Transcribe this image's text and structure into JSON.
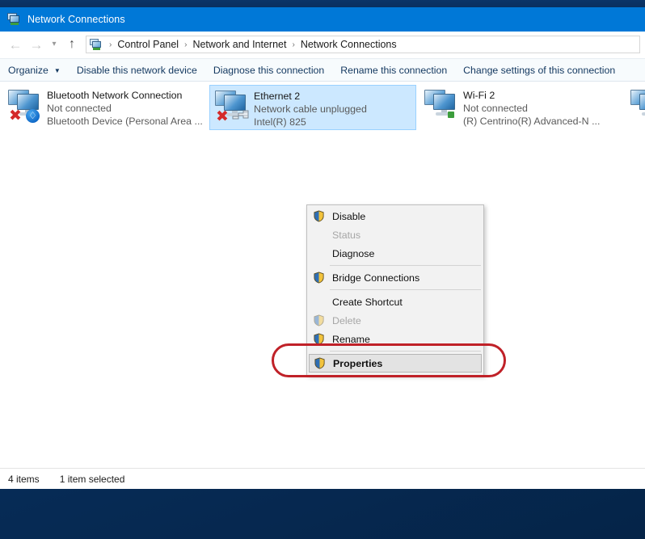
{
  "window": {
    "title": "Network Connections",
    "title_icon": "network-connections-icon"
  },
  "navigation": {
    "back_icon": "back-arrow-icon",
    "forward_icon": "forward-arrow-icon",
    "history_icon": "chevron-down-icon",
    "up_icon": "up-arrow-icon",
    "address_icon": "network-connections-icon",
    "breadcrumbs": [
      {
        "label": "Control Panel"
      },
      {
        "label": "Network and Internet"
      },
      {
        "label": "Network Connections"
      }
    ],
    "separator": "›"
  },
  "command_bar": {
    "items": [
      {
        "label": "Organize",
        "has_caret": true
      },
      {
        "label": "Disable this network device",
        "has_caret": false
      },
      {
        "label": "Diagnose this connection",
        "has_caret": false
      },
      {
        "label": "Rename this connection",
        "has_caret": false
      },
      {
        "label": "Change settings of this connection",
        "has_caret": false
      }
    ],
    "caret": "▼"
  },
  "connections": [
    {
      "name": "Bluetooth Network Connection",
      "status": "Not connected",
      "device": "Bluetooth Device (Personal Area ...",
      "icon": "network-adapter-icon",
      "badge": "bluetooth-badge-icon",
      "badge_glyph": "ᛦ",
      "disconnected": true,
      "selected": false
    },
    {
      "name": "Ethernet 2",
      "status": "Network cable unplugged",
      "device": "Intel(R) 825",
      "icon": "network-adapter-icon",
      "badge": "unplugged-cable-badge-icon",
      "disconnected": true,
      "selected": true
    },
    {
      "name": "Wi-Fi 2",
      "status": "Not connected",
      "device": "(R) Centrino(R) Advanced-N ...",
      "icon": "network-adapter-icon",
      "badge": "green-connector-badge-icon",
      "disconnected": false,
      "selected": false
    }
  ],
  "context_menu": {
    "items": [
      {
        "label": "Disable",
        "shield": true,
        "disabled": false,
        "bold": false,
        "highlighted": false,
        "separator_after": false
      },
      {
        "label": "Status",
        "shield": false,
        "disabled": true,
        "bold": false,
        "highlighted": false,
        "separator_after": false
      },
      {
        "label": "Diagnose",
        "shield": false,
        "disabled": false,
        "bold": false,
        "highlighted": false,
        "separator_after": true
      },
      {
        "label": "Bridge Connections",
        "shield": true,
        "disabled": false,
        "bold": false,
        "highlighted": false,
        "separator_after": true
      },
      {
        "label": "Create Shortcut",
        "shield": false,
        "disabled": false,
        "bold": false,
        "highlighted": false,
        "separator_after": false
      },
      {
        "label": "Delete",
        "shield": true,
        "disabled": true,
        "bold": false,
        "highlighted": false,
        "separator_after": false
      },
      {
        "label": "Rename",
        "shield": true,
        "disabled": false,
        "bold": false,
        "highlighted": false,
        "separator_after": true
      },
      {
        "label": "Properties",
        "shield": true,
        "disabled": false,
        "bold": true,
        "highlighted": true,
        "separator_after": false
      }
    ]
  },
  "annotation": {
    "name": "properties-highlight-oval",
    "color": "#c02128"
  },
  "status_bar": {
    "item_count": "4 items",
    "selection": "1 item selected"
  },
  "colors": {
    "titlebar": "#0078d7",
    "selection_fill": "#cce8ff",
    "selection_border": "#99d1ff",
    "menu_bg": "#f2f2f2",
    "annotation": "#c02128",
    "command_text": "#12375f"
  }
}
